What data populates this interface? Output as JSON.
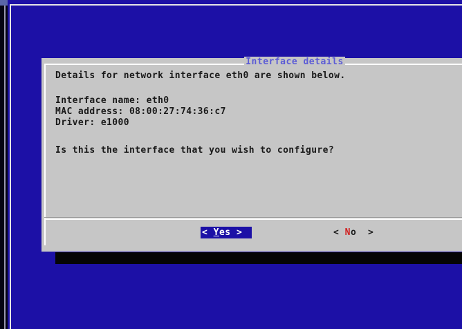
{
  "dialog": {
    "title": "Interface details",
    "intro": "Details for network interface eth0 are shown below.",
    "details": [
      "Interface name: eth0",
      "MAC address: 08:00:27:74:36:c7",
      "Driver: e1000"
    ],
    "question": "Is this the interface that you wish to configure?"
  },
  "buttons": {
    "yes": {
      "open": "<",
      "hotkey": "Y",
      "rest": "es",
      "close": ">"
    },
    "no": {
      "open": "<",
      "hotkey": "N",
      "rest": "o",
      "close": ">"
    }
  },
  "colors": {
    "background": "#1c10a6",
    "dialog": "#c6c6c6",
    "title": "#5b5bd6",
    "hotkey_no": "#d02020",
    "selected_button": "#1c10a6"
  }
}
